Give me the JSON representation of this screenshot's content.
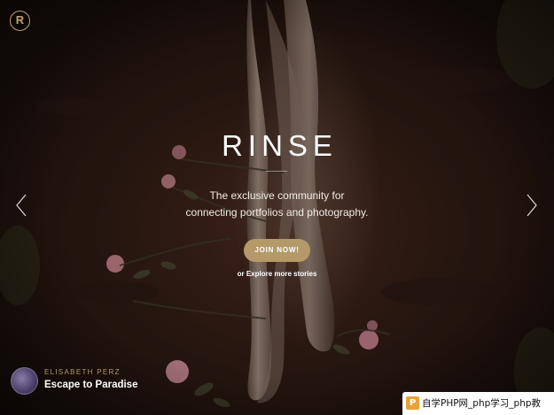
{
  "brand": {
    "logo_letter": "R",
    "name": "RINSE"
  },
  "hero": {
    "tagline_line1": "The exclusive community for",
    "tagline_line2": "connecting portfolios and photography.",
    "cta_label": "JOIN NOW!",
    "explore_label": "or Explore more stories"
  },
  "carousel": {
    "prev_icon": "chevron-left-icon",
    "next_icon": "chevron-right-icon"
  },
  "credit": {
    "author": "ELISABETH PERZ",
    "story_title": "Escape to Paradise"
  },
  "watermark": {
    "badge": "P",
    "text": "自学PHP网_php学习_php教"
  },
  "colors": {
    "accent_gold": "#b49a69",
    "background_dark": "#1a0f0b",
    "text_white": "#ffffff"
  }
}
